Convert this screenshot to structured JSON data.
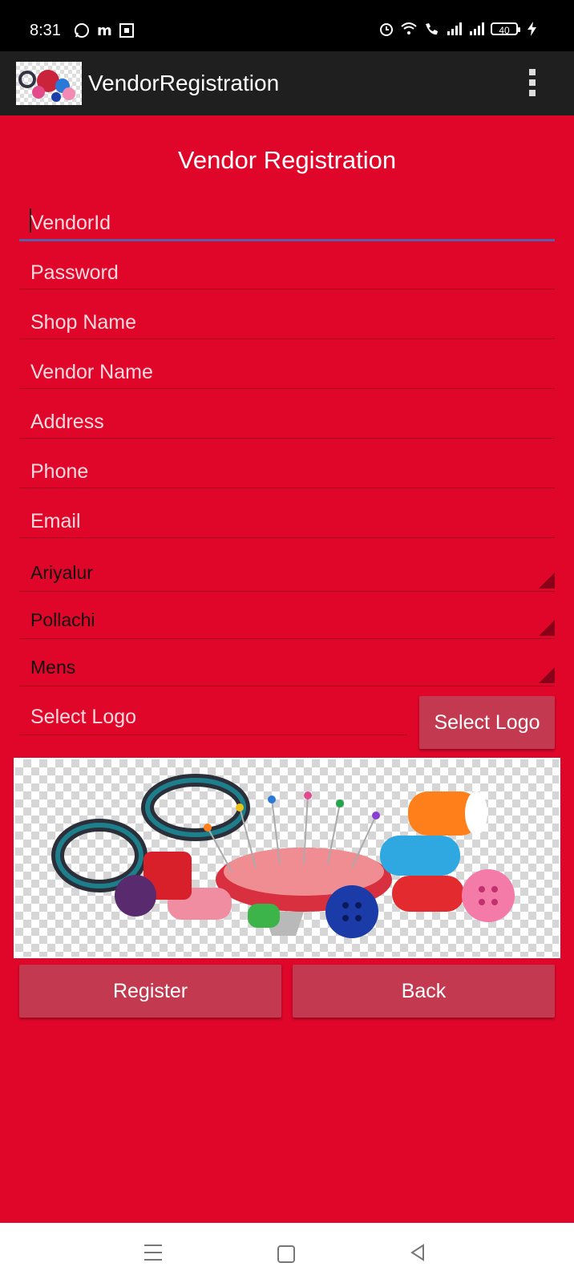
{
  "status_bar": {
    "time": "8:31",
    "battery": "40"
  },
  "app_bar": {
    "title": "VendorRegistration"
  },
  "form": {
    "heading": "Vendor Registration",
    "fields": [
      {
        "placeholder": "VendorId"
      },
      {
        "placeholder": "Password"
      },
      {
        "placeholder": "Shop Name"
      },
      {
        "placeholder": "Vendor Name"
      },
      {
        "placeholder": "Address"
      },
      {
        "placeholder": "Phone"
      },
      {
        "placeholder": "Email"
      }
    ],
    "spinners": [
      {
        "value": "Ariyalur"
      },
      {
        "value": "Pollachi"
      },
      {
        "value": "Mens"
      }
    ],
    "logo_field": {
      "placeholder": "Select Logo"
    },
    "select_logo_button": "Select Logo",
    "register_button": "Register",
    "back_button": "Back"
  },
  "colors": {
    "background": "#e0062a",
    "button": "#c33a50",
    "appbar": "#1f1f1f"
  }
}
